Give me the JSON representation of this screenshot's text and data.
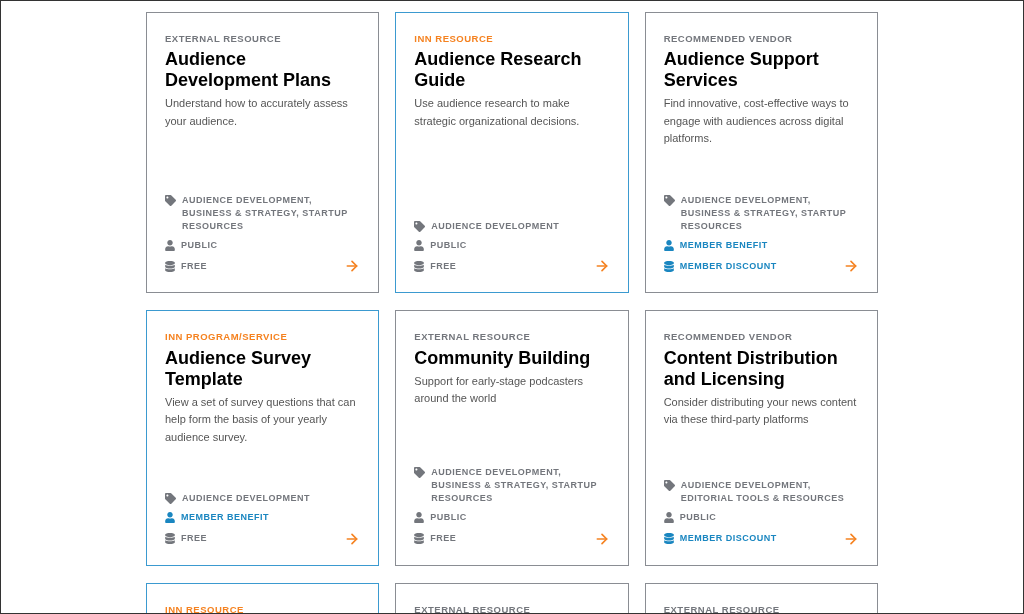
{
  "cards": [
    {
      "kind": "external",
      "category": "EXTERNAL RESOURCE",
      "title": "Audience Development Plans",
      "description": "Understand how to accurately assess your audience.",
      "topics": "AUDIENCE DEVELOPMENT, BUSINESS & STRATEGY, STARTUP RESOURCES",
      "access": {
        "text": "PUBLIC",
        "member": false
      },
      "cost": {
        "text": "FREE",
        "member": false
      }
    },
    {
      "kind": "inn",
      "category": "INN RESOURCE",
      "title": "Audience Research Guide",
      "description": "Use audience research to make strategic organizational decisions.",
      "topics": "AUDIENCE DEVELOPMENT",
      "access": {
        "text": "PUBLIC",
        "member": false
      },
      "cost": {
        "text": "FREE",
        "member": false
      }
    },
    {
      "kind": "external",
      "category": "RECOMMENDED VENDOR",
      "title": "Audience Support Services",
      "description": "Find innovative, cost-effective ways to engage with audiences across digital platforms.",
      "topics": "AUDIENCE DEVELOPMENT, BUSINESS & STRATEGY, STARTUP RESOURCES",
      "access": {
        "text": "MEMBER BENEFIT",
        "member": true
      },
      "cost": {
        "text": "MEMBER DISCOUNT",
        "member": true
      }
    },
    {
      "kind": "inn",
      "category": "INN PROGRAM/SERVICE",
      "title": "Audience Survey Template",
      "description": "View a set of survey questions that can help form the basis of your yearly audience survey.",
      "topics": "AUDIENCE DEVELOPMENT",
      "access": {
        "text": "MEMBER BENEFIT",
        "member": true
      },
      "cost": {
        "text": "FREE",
        "member": false
      }
    },
    {
      "kind": "external",
      "category": "EXTERNAL RESOURCE",
      "title": "Community Building",
      "description": "Support for early-stage podcasters around the world",
      "topics": "AUDIENCE DEVELOPMENT, BUSINESS & STRATEGY, STARTUP RESOURCES",
      "access": {
        "text": "PUBLIC",
        "member": false
      },
      "cost": {
        "text": "FREE",
        "member": false
      }
    },
    {
      "kind": "external",
      "category": "RECOMMENDED VENDOR",
      "title": "Content Distribution and Licensing",
      "description": "Consider distributing your news content via these third-party platforms",
      "topics": "AUDIENCE DEVELOPMENT, EDITORIAL TOOLS & RESOURCES",
      "access": {
        "text": "PUBLIC",
        "member": false
      },
      "cost": {
        "text": "MEMBER DISCOUNT",
        "member": true
      }
    },
    {
      "kind": "inn",
      "category": "INN RESOURCE"
    },
    {
      "kind": "external",
      "category": "EXTERNAL RESOURCE"
    },
    {
      "kind": "external",
      "category": "EXTERNAL RESOURCE"
    }
  ]
}
